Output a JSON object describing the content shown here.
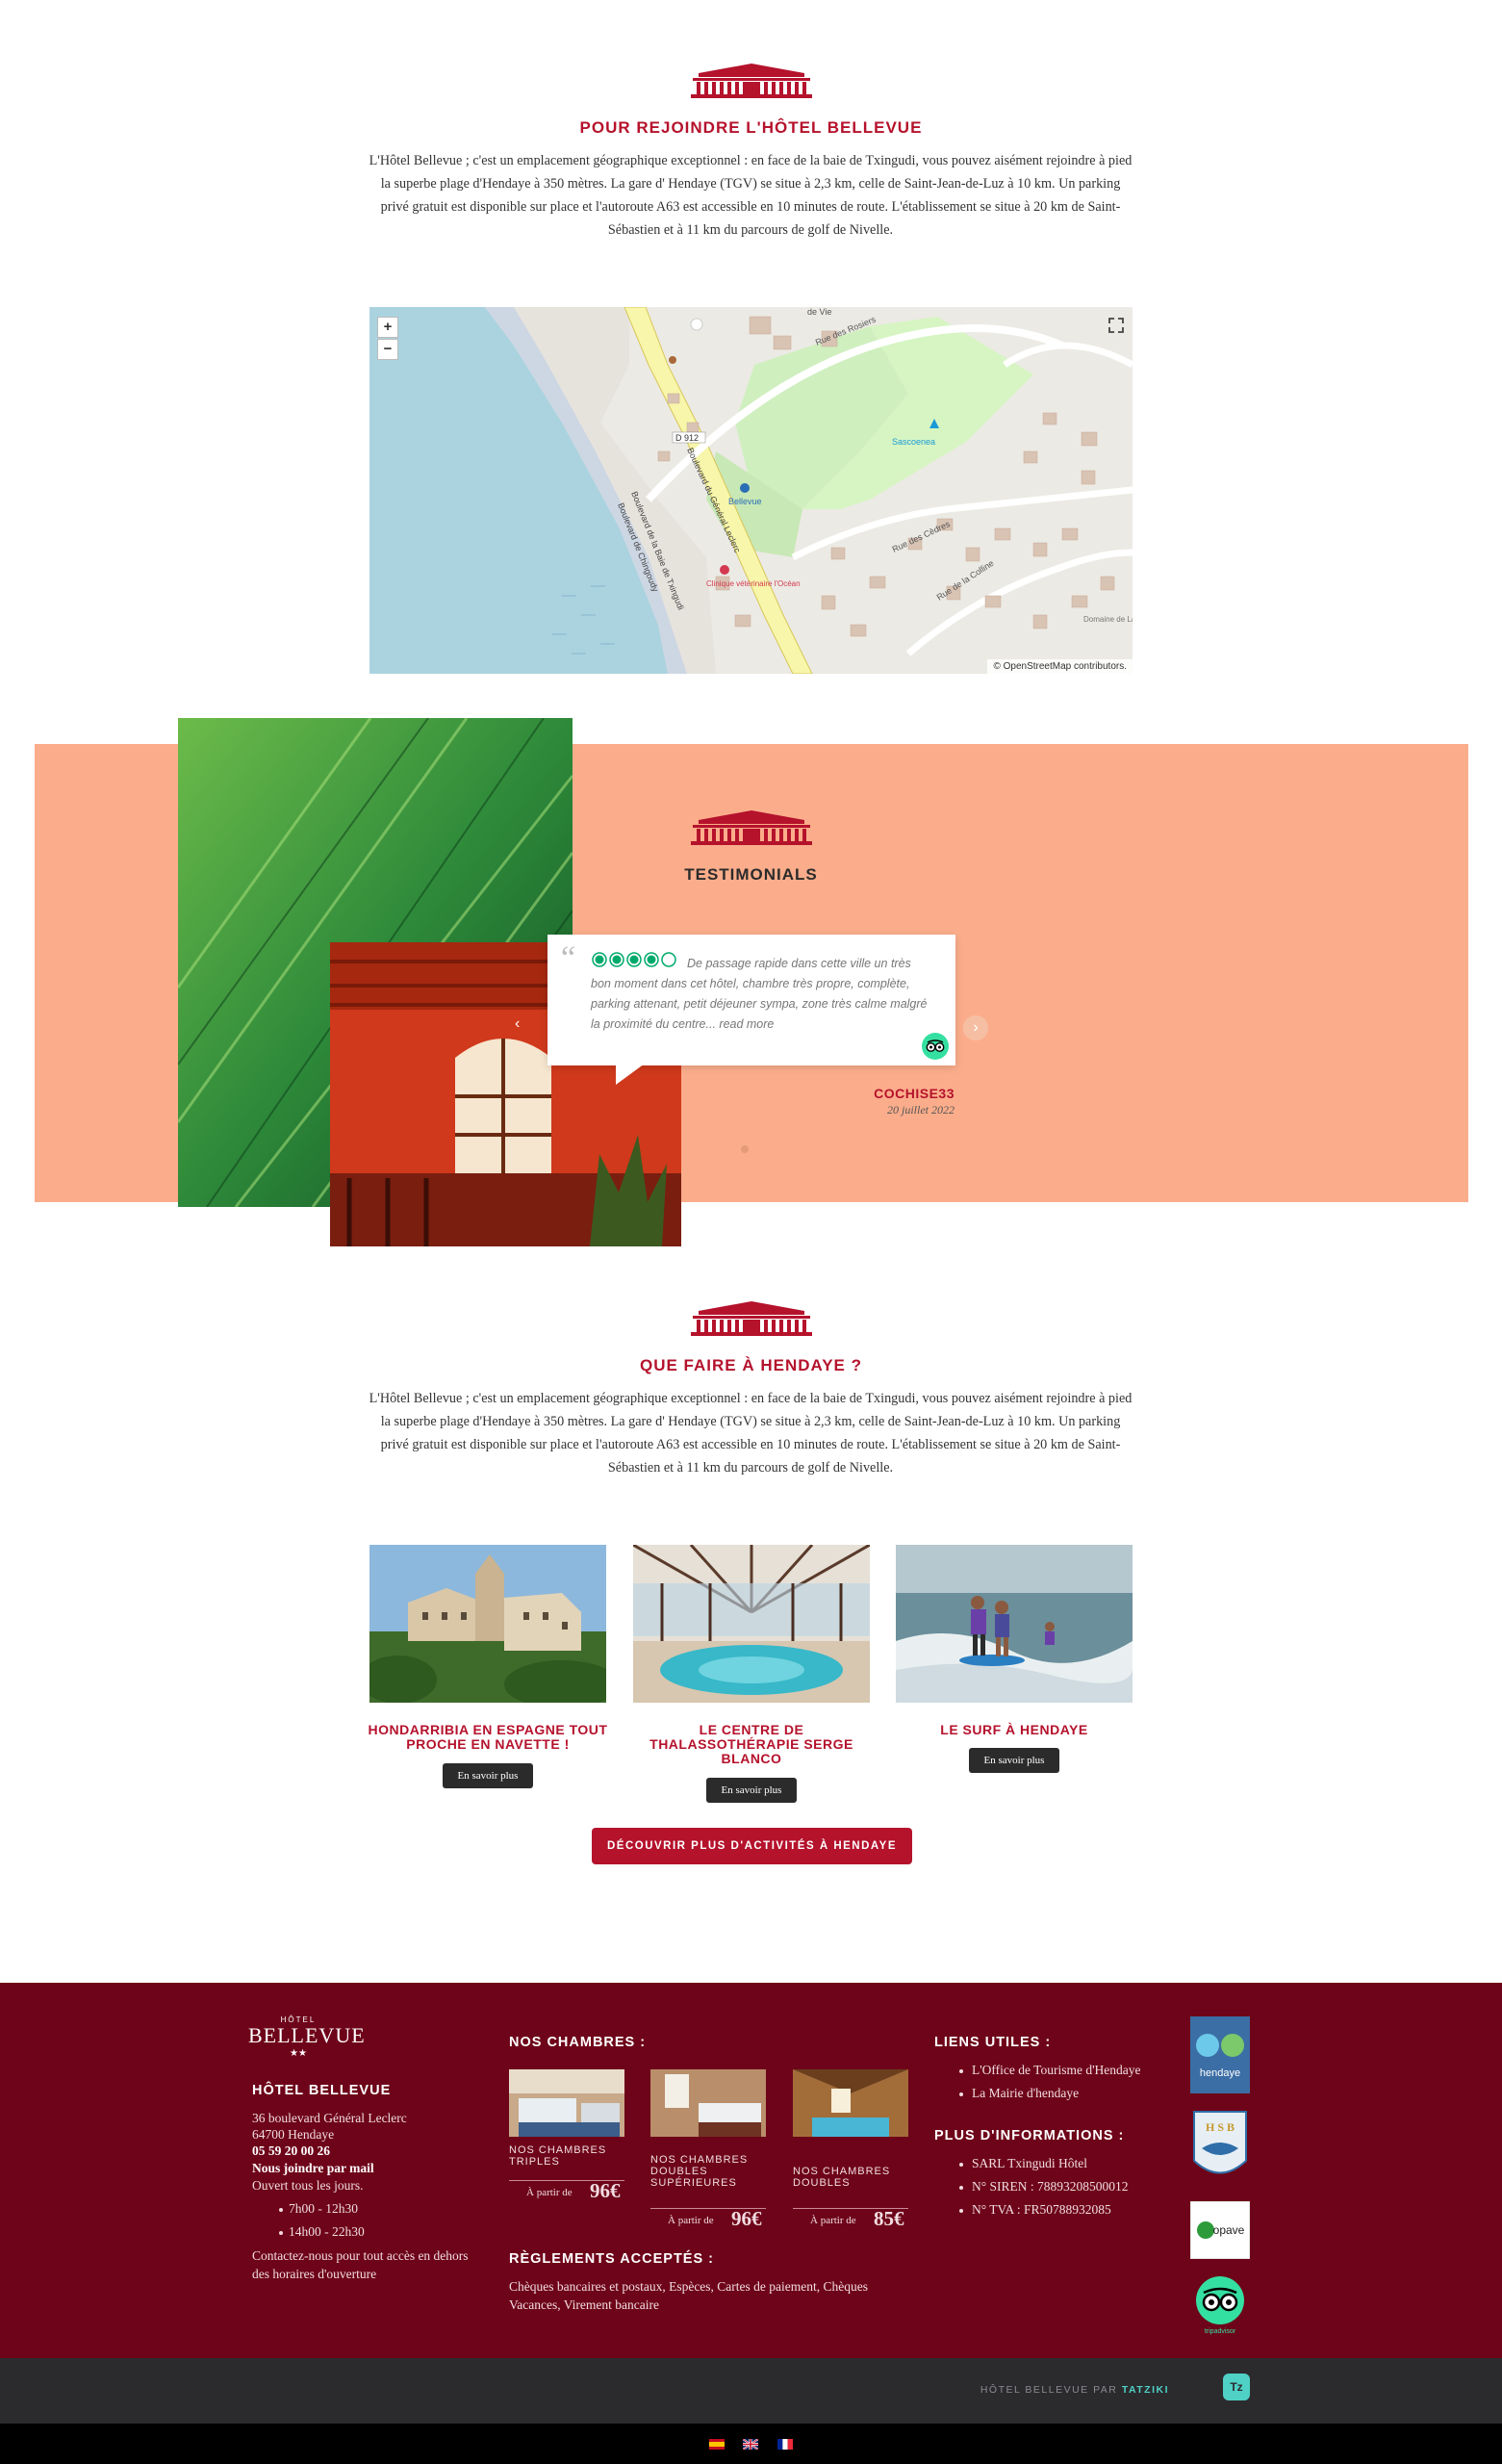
{
  "section1": {
    "title": "POUR REJOINDRE L'HÔTEL BELLEVUE",
    "paragraph": "L'Hôtel Bellevue ; c'est un emplacement géographique exceptionnel : en face de la baie de Txingudi, vous pouvez aisément rejoindre à pied la superbe plage d'Hendaye à 350 mètres. La gare d' Hendaye (TGV) se situe à 2,3 km, celle de Saint-Jean-de-Luz à 10 km. Un parking privé gratuit est disponible sur place et l'autoroute A63 est accessible en 10 minutes de route. L'établissement se situe à 20 km de Saint-Sébastien et à 11 km du parcours de golf de Nivelle."
  },
  "map": {
    "zoom_in": "+",
    "zoom_out": "−",
    "attribution": "© OpenStreetMap contributors.",
    "labels": {
      "road_d912": "D 912",
      "rue_rosiers": "Rue des Rosiers",
      "boulevard_leclerc": "Boulevard du Général Leclerc",
      "boulevard_baie": "Boulevard de la Baie de Txingudi",
      "boulevard_chingoudy": "Boulevard de Chingoudy",
      "sascoenea": "Sascoenea",
      "bellevue": "Bellevue",
      "clinique": "Clinique vétérinaire l'Océan",
      "rue_cedres": "Rue des Cèdres",
      "rue_colline": "Rue de la Colline",
      "domaine": "Domaine de Larreun",
      "vie": "de Vie"
    }
  },
  "testimonials": {
    "title": "TESTIMONIALS",
    "review": "De passage rapide dans cette ville un très bon moment dans cet hôtel, chambre très propre, complète, parking attenant, petit déjeuner sympa, zone très calme malgré la proximité du centre...",
    "read_more": "read more",
    "author": "COCHISE33",
    "date": "20 juillet 2022",
    "rating": 4,
    "rating_max": 5
  },
  "section2": {
    "title": "QUE FAIRE À HENDAYE ?",
    "paragraph": "L'Hôtel Bellevue ; c'est un emplacement géographique exceptionnel : en face de la baie de Txingudi, vous pouvez aisément rejoindre à pied la superbe plage d'Hendaye à 350 mètres. La gare d' Hendaye (TGV) se situe à 2,3 km, celle de Saint-Jean-de-Luz à 10 km. Un parking privé gratuit est disponible sur place et l'autoroute A63 est accessible en 10 minutes de route. L'établissement se situe à 20 km de Saint-Sébastien et à 11 km du parcours de golf de Nivelle."
  },
  "activities": [
    {
      "title": "HONDARRIBIA EN ESPAGNE TOUT PROCHE EN NAVETTE !",
      "button": "En savoir plus"
    },
    {
      "title": "LE CENTRE DE THALASSOTHÉRAPIE SERGE BLANCO",
      "button": "En savoir plus"
    },
    {
      "title": "LE SURF À HENDAYE",
      "button": "En savoir plus"
    }
  ],
  "discover_button": "DÉCOUVRIR PLUS D'ACTIVITÉS À HENDAYE",
  "footer": {
    "logo_small": "HÔTEL",
    "logo_big": "BELLEVUE",
    "logo_stars": "★★",
    "hotel_heading": "HÔTEL BELLEVUE",
    "address1": "36 boulevard Général Leclerc",
    "address2": "64700 Hendaye",
    "phone": "05 59 20 00 26",
    "mail_link": "Nous joindre par mail",
    "open": "Ouvert tous les jours.",
    "hours": [
      "7h00 - 12h30",
      "14h00 - 22h30"
    ],
    "contact_note": "Contactez-nous pour tout accès en dehors des horaires d'ouverture",
    "rooms_heading": "NOS CHAMBRES :",
    "rooms": [
      {
        "label": "NOS CHAMBRES TRIPLES",
        "from": "À partir de",
        "price": "96€"
      },
      {
        "label": "NOS CHAMBRES DOUBLES SUPÉRIEURES",
        "from": "À partir de",
        "price": "96€"
      },
      {
        "label": "NOS CHAMBRES DOUBLES",
        "from": "À partir de",
        "price": "85€"
      }
    ],
    "payment_heading": "RÈGLEMENTS ACCEPTÉS :",
    "payment_text": "Chèques bancaires et postaux, Espèces, Cartes de paiement, Chèques Vacances, Virement bancaire",
    "links_heading": "LIENS UTILES :",
    "links": [
      "L'Office de Tourisme d'Hendaye",
      "La Mairie d'hendaye"
    ],
    "info_heading": "PLUS D'INFORMATIONS :",
    "info": [
      "SARL Txingudi Hôtel",
      "N° SIREN : 78893208500012",
      "N° TVA : FR50788932085"
    ],
    "badges": {
      "hendaye": "hendaye",
      "hsb": "H S B",
      "opave": "opave",
      "tripadvisor": "tripadvisor"
    }
  },
  "credits": {
    "text": "HÔTEL BELLEVUE PAR",
    "brand": "TATZIKI",
    "badge": "Tz"
  },
  "colors": {
    "accent": "#b5122c",
    "footer_bg": "#6e0419",
    "testimonial_bg": "#fbad8b",
    "tripadvisor_green": "#34e0a1"
  }
}
